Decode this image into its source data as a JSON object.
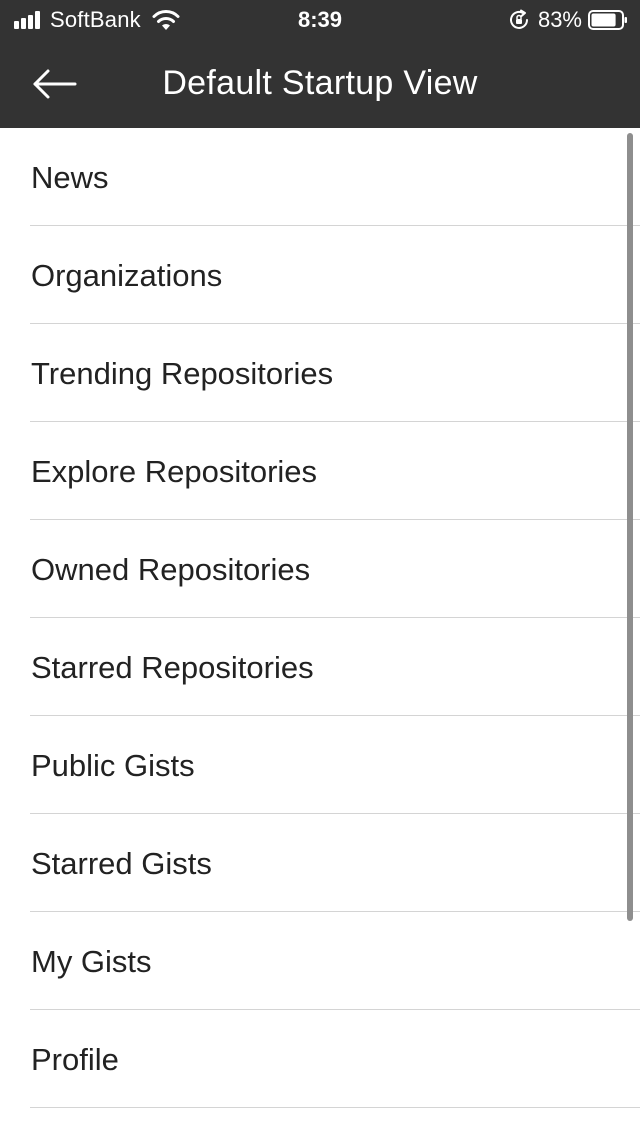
{
  "status_bar": {
    "carrier": "SoftBank",
    "time": "8:39",
    "battery_percent": "83%",
    "battery_level": 0.83
  },
  "nav": {
    "title": "Default Startup View",
    "back_icon": "back-arrow-icon"
  },
  "list": {
    "items": [
      {
        "label": "News"
      },
      {
        "label": "Organizations"
      },
      {
        "label": "Trending Repositories"
      },
      {
        "label": "Explore Repositories"
      },
      {
        "label": "Owned Repositories"
      },
      {
        "label": "Starred Repositories"
      },
      {
        "label": "Public Gists"
      },
      {
        "label": "Starred Gists"
      },
      {
        "label": "My Gists"
      },
      {
        "label": "Profile"
      }
    ]
  },
  "colors": {
    "bar_background": "#333333",
    "bar_text": "#ffffff",
    "list_text": "#222222",
    "divider": "#d4d4d4",
    "scrollbar": "#8e8e8e"
  }
}
